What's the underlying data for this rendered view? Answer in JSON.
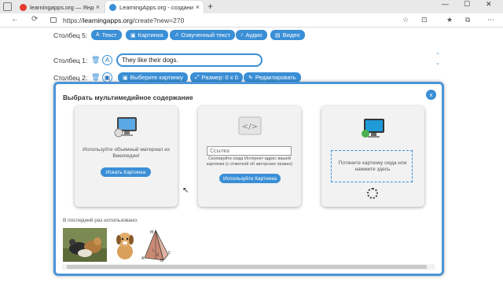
{
  "browser": {
    "tabs": [
      {
        "title": "learningapps.org — Яндекс: нап",
        "close": "×",
        "fav_color": "#e6392c"
      },
      {
        "title": "LearningApps.org - создание м",
        "close": "×",
        "fav_color": "#3a8fd6"
      }
    ],
    "new_tab": "+",
    "window_controls": [
      "—",
      "☐",
      "✕"
    ],
    "nav": {
      "back": "←",
      "refresh": "⟳"
    },
    "url_prefix": "https://",
    "url_host": "learningapps.org",
    "url_path": "/create?new=270",
    "toolbar_icons": [
      "☆",
      "⊡",
      "★",
      "⧉",
      "⋯"
    ]
  },
  "editor": {
    "row5_label": "Столбец 5:",
    "row5_buttons": [
      {
        "icon": "A",
        "label": "Текст"
      },
      {
        "icon": "▣",
        "label": "Картинка"
      },
      {
        "icon": "♫",
        "label": "Озвученный текст"
      },
      {
        "icon": "♪",
        "label": "Аудио"
      },
      {
        "icon": "▤",
        "label": "Видео"
      }
    ],
    "row1_label": "Столбец 1:",
    "row1_trash": "🗑",
    "row1_type_icon": "A",
    "row1_value": "They like their dogs.",
    "row2_label": "Столбец 2:",
    "row2_trash": "🗑",
    "row2_type_icon": "▣",
    "row2_buttons": [
      {
        "icon": "▣",
        "label": "Выберите картинку"
      },
      {
        "icon": "⤢",
        "label": "Размер: 0 x 0"
      },
      {
        "icon": "✎",
        "label": "Редактировать"
      }
    ],
    "chevrons": [
      "⌃",
      "⌄"
    ]
  },
  "modal": {
    "title": "Выбрать мультимедийное содержание",
    "close": "x",
    "wiki_card": {
      "text": "Используйте объемный материал из Википедии!",
      "button": "Искать Картинка"
    },
    "link_card": {
      "placeholder": "Ссылка",
      "hint": "Скопируйте сюда Интернет-адрес вашей картинки (с отметкой об авторских правах)",
      "button": "Используйте Картинка"
    },
    "upload_card": {
      "text": "Потяните картинку сюда или нажмите здесь"
    },
    "recent_label": "В последний раз использовано:",
    "recent_items": [
      {
        "name": "cat-and-dogs"
      },
      {
        "name": "puppy"
      },
      {
        "name": "pyramid"
      }
    ],
    "pyramid_letters": [
      "M",
      "A",
      "B",
      "C",
      "D",
      "L"
    ]
  },
  "colors": {
    "accent": "#3a8fd6",
    "modal_border": "#4b95d8"
  }
}
